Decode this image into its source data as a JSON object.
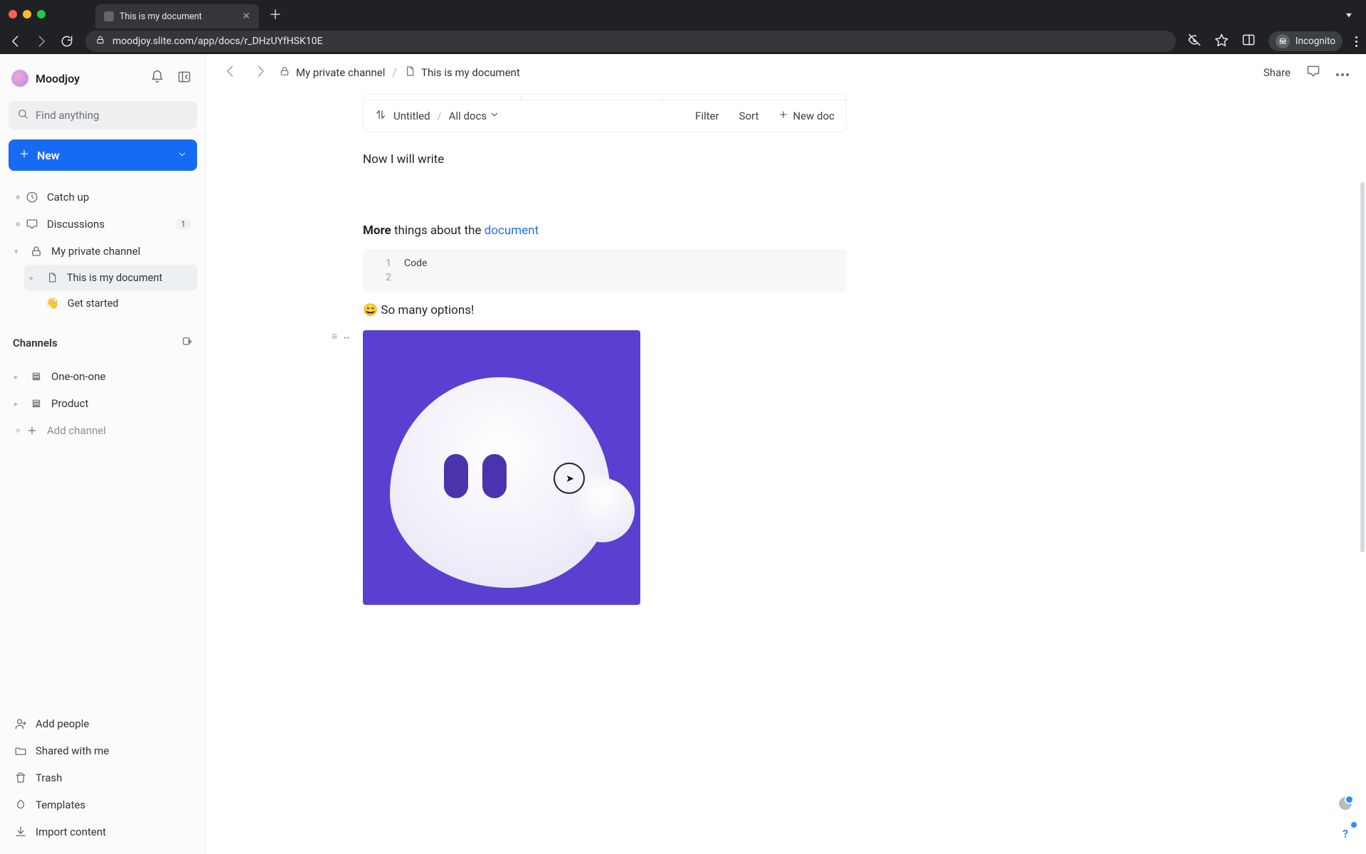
{
  "browser": {
    "tab_title": "This is my document",
    "url": "moodjoy.slite.com/app/docs/r_DHzUYfHSK10E",
    "incognito_label": "Incognito"
  },
  "workspace": {
    "name": "Moodjoy"
  },
  "search": {
    "placeholder": "Find anything"
  },
  "new_button": {
    "label": "New"
  },
  "nav": {
    "catch_up": "Catch up",
    "discussions": "Discussions",
    "discussions_badge": "1",
    "my_private_channel": "My private channel",
    "doc_current": "This is my document",
    "get_started": "Get started"
  },
  "channels": {
    "header": "Channels",
    "items": [
      "One-on-one",
      "Product"
    ],
    "add": "Add channel"
  },
  "footer": {
    "add_people": "Add people",
    "shared": "Shared with me",
    "trash": "Trash",
    "templates": "Templates",
    "import": "Import content"
  },
  "breadcrumbs": {
    "a": "My private channel",
    "b": "This is my document"
  },
  "topbar": {
    "share": "Share"
  },
  "doc_bar": {
    "untitled": "Untitled",
    "all_docs": "All docs",
    "filter": "Filter",
    "sort": "Sort",
    "new_doc": "New doc"
  },
  "content": {
    "line1": "Now I will write",
    "more_prefix": "More",
    "more_mid": " things about the ",
    "more_link": "document",
    "code_l1": "Code",
    "emoji": "😄",
    "options": " So many options!"
  },
  "help": {
    "q": "?"
  }
}
